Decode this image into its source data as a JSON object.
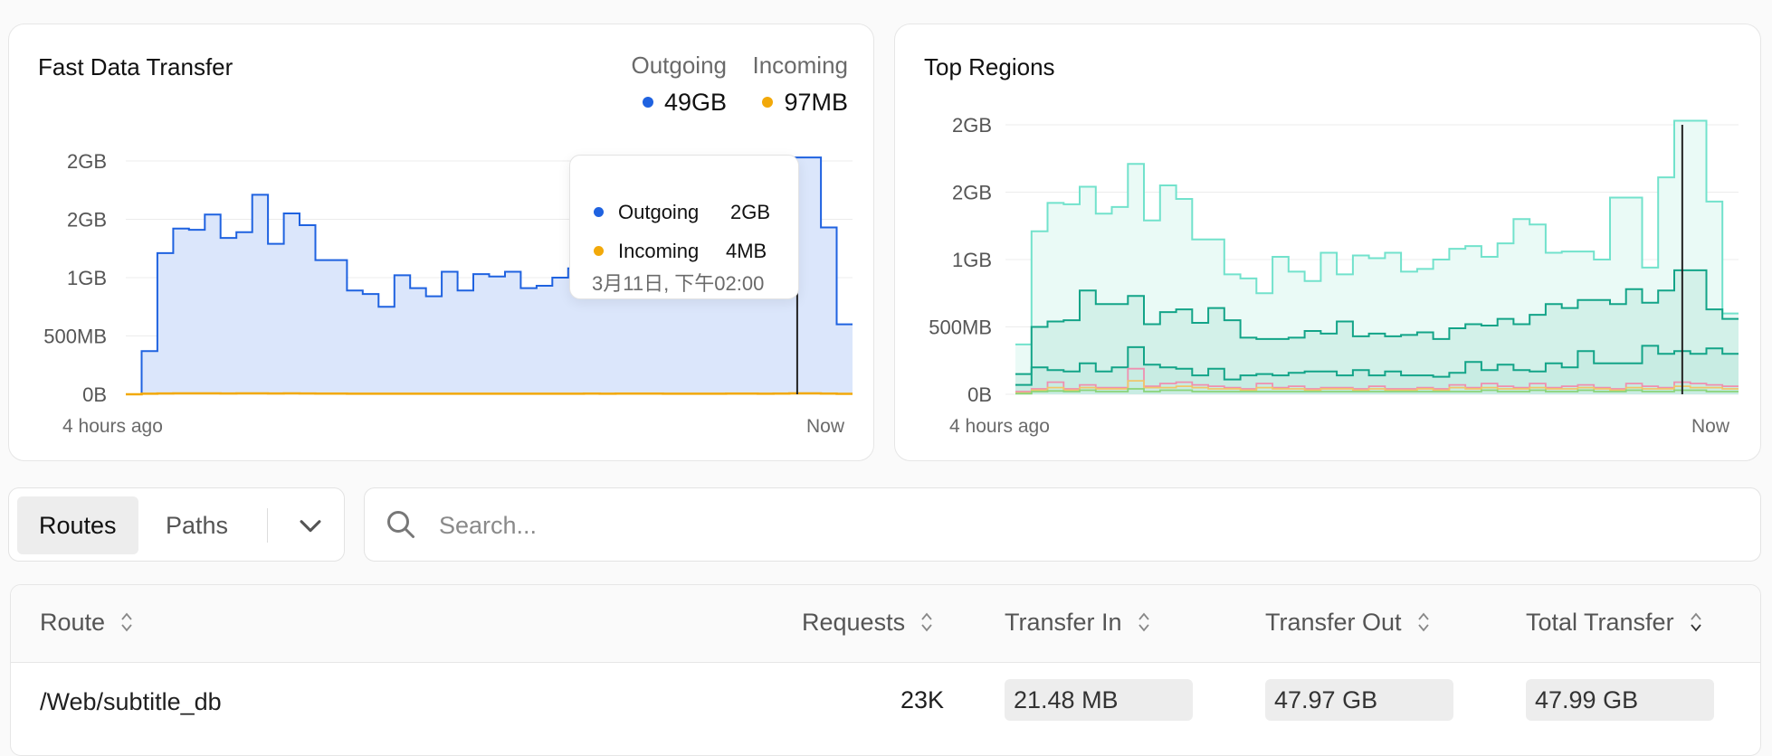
{
  "fast_data_transfer": {
    "title": "Fast Data Transfer",
    "outgoing_label": "Outgoing",
    "outgoing_total": "49GB",
    "incoming_label": "Incoming",
    "incoming_total": "97MB",
    "x_start_label": "4 hours ago",
    "x_end_label": "Now",
    "tooltip": {
      "outgoing_label": "Outgoing",
      "outgoing_value": "2GB",
      "incoming_label": "Incoming",
      "incoming_value": "4MB",
      "time": "3月11日, 下午02:00"
    }
  },
  "top_regions": {
    "title": "Top Regions",
    "x_start_label": "4 hours ago",
    "x_end_label": "Now"
  },
  "colors": {
    "outgoing": "#1f62e0",
    "incoming": "#f2a90a",
    "outgoing_fill": "#dbe6fb",
    "region_light": "#72e2cc",
    "region_dark": "#13a488",
    "region_pink": "#ef8fb0",
    "region_yellow": "#f0c66a",
    "region_lime": "#8ad47a"
  },
  "chart_data": [
    {
      "type": "area",
      "title": "Fast Data Transfer",
      "y_ticks": [
        "2GB",
        "2GB",
        "1GB",
        "500MB",
        "0B"
      ],
      "y_tick_values": [
        2.0,
        1.5,
        1.0,
        0.5,
        0
      ],
      "ylim": [
        0,
        2.0
      ],
      "series": [
        {
          "name": "Outgoing",
          "values": [
            0,
            0.37,
            1.21,
            1.42,
            1.41,
            1.54,
            1.34,
            1.39,
            1.71,
            1.29,
            1.55,
            1.45,
            1.15,
            1.15,
            0.89,
            0.86,
            0.75,
            1.02,
            0.91,
            0.84,
            1.05,
            0.89,
            1.03,
            1.01,
            1.05,
            0.91,
            0.93,
            1.0,
            1.08,
            1.1,
            1.02,
            1.12,
            1.3,
            1.26,
            1.05,
            1.06,
            1.06,
            1.0,
            1.46,
            1.46,
            0.94,
            1.61,
            2.03,
            2.03,
            1.43,
            0.6
          ]
        },
        {
          "name": "Incoming",
          "values": [
            0,
            0.005,
            0.007,
            0.008,
            0.008,
            0.008,
            0.007,
            0.008,
            0.008,
            0.007,
            0.008,
            0.007,
            0.006,
            0.006,
            0.005,
            0.005,
            0.005,
            0.005,
            0.005,
            0.005,
            0.005,
            0.005,
            0.005,
            0.005,
            0.005,
            0.005,
            0.005,
            0.005,
            0.005,
            0.006,
            0.005,
            0.006,
            0.006,
            0.006,
            0.005,
            0.005,
            0.005,
            0.005,
            0.006,
            0.006,
            0.005,
            0.006,
            0.008,
            0.008,
            0.006,
            0.004
          ]
        }
      ],
      "cursor_index": 42
    },
    {
      "type": "area",
      "title": "Top Regions",
      "y_ticks": [
        "2GB",
        "2GB",
        "1GB",
        "500MB",
        "0B"
      ],
      "y_tick_values": [
        2.0,
        1.5,
        1.0,
        0.5,
        0
      ],
      "ylim": [
        0,
        2.0
      ],
      "series": [
        {
          "values": [
            0.37,
            1.21,
            1.42,
            1.41,
            1.54,
            1.34,
            1.39,
            1.71,
            1.29,
            1.55,
            1.45,
            1.15,
            1.15,
            0.89,
            0.86,
            0.75,
            1.02,
            0.91,
            0.84,
            1.05,
            0.89,
            1.03,
            1.01,
            1.05,
            0.91,
            0.93,
            1.0,
            1.08,
            1.1,
            1.02,
            1.12,
            1.3,
            1.26,
            1.05,
            1.06,
            1.06,
            1.0,
            1.46,
            1.46,
            0.94,
            1.61,
            2.03,
            2.03,
            1.43,
            0.6
          ]
        },
        {
          "values": [
            0.15,
            0.5,
            0.54,
            0.55,
            0.77,
            0.67,
            0.67,
            0.73,
            0.52,
            0.61,
            0.63,
            0.53,
            0.64,
            0.55,
            0.42,
            0.41,
            0.41,
            0.42,
            0.47,
            0.45,
            0.54,
            0.43,
            0.45,
            0.43,
            0.44,
            0.46,
            0.41,
            0.49,
            0.52,
            0.51,
            0.56,
            0.52,
            0.59,
            0.67,
            0.64,
            0.7,
            0.7,
            0.67,
            0.78,
            0.68,
            0.77,
            0.92,
            0.92,
            0.63,
            0.56
          ]
        },
        {
          "values": [
            0.07,
            0.2,
            0.18,
            0.17,
            0.23,
            0.17,
            0.2,
            0.35,
            0.22,
            0.2,
            0.19,
            0.14,
            0.19,
            0.11,
            0.14,
            0.15,
            0.14,
            0.16,
            0.17,
            0.17,
            0.14,
            0.18,
            0.14,
            0.17,
            0.14,
            0.14,
            0.13,
            0.16,
            0.24,
            0.18,
            0.22,
            0.18,
            0.17,
            0.23,
            0.2,
            0.32,
            0.23,
            0.23,
            0.23,
            0.36,
            0.3,
            0.32,
            0.3,
            0.34,
            0.3
          ]
        },
        {
          "values": [
            0.02,
            0.04,
            0.09,
            0.04,
            0.07,
            0.05,
            0.05,
            0.19,
            0.06,
            0.08,
            0.09,
            0.07,
            0.06,
            0.05,
            0.04,
            0.08,
            0.05,
            0.06,
            0.04,
            0.05,
            0.05,
            0.04,
            0.06,
            0.04,
            0.04,
            0.05,
            0.04,
            0.07,
            0.05,
            0.08,
            0.06,
            0.05,
            0.08,
            0.05,
            0.06,
            0.07,
            0.05,
            0.04,
            0.08,
            0.06,
            0.05,
            0.09,
            0.08,
            0.07,
            0.06
          ]
        },
        {
          "values": [
            0.01,
            0.03,
            0.05,
            0.03,
            0.05,
            0.04,
            0.04,
            0.1,
            0.05,
            0.05,
            0.06,
            0.05,
            0.04,
            0.04,
            0.03,
            0.05,
            0.04,
            0.04,
            0.03,
            0.04,
            0.04,
            0.03,
            0.04,
            0.03,
            0.03,
            0.04,
            0.03,
            0.05,
            0.04,
            0.05,
            0.04,
            0.04,
            0.05,
            0.04,
            0.04,
            0.05,
            0.04,
            0.03,
            0.05,
            0.04,
            0.04,
            0.06,
            0.05,
            0.05,
            0.04
          ]
        },
        {
          "values": [
            0.005,
            0.02,
            0.025,
            0.02,
            0.03,
            0.02,
            0.02,
            0.04,
            0.02,
            0.03,
            0.03,
            0.02,
            0.02,
            0.02,
            0.02,
            0.02,
            0.02,
            0.02,
            0.02,
            0.02,
            0.02,
            0.02,
            0.02,
            0.02,
            0.02,
            0.02,
            0.02,
            0.02,
            0.02,
            0.03,
            0.02,
            0.02,
            0.03,
            0.02,
            0.02,
            0.03,
            0.02,
            0.02,
            0.03,
            0.02,
            0.02,
            0.03,
            0.03,
            0.02,
            0.02
          ]
        }
      ],
      "cursor_index": 41
    }
  ],
  "segment": {
    "options": [
      "Routes",
      "Paths"
    ],
    "selected": "Routes"
  },
  "search": {
    "placeholder": "Search...",
    "value": ""
  },
  "table": {
    "columns": [
      "Route",
      "Requests",
      "Transfer In",
      "Transfer Out",
      "Total Transfer"
    ],
    "rows": [
      {
        "route": "/Web/subtitle_db",
        "requests": "23K",
        "transfer_in": "21.48 MB",
        "transfer_out": "47.97 GB",
        "total_transfer": "47.99 GB"
      }
    ]
  }
}
